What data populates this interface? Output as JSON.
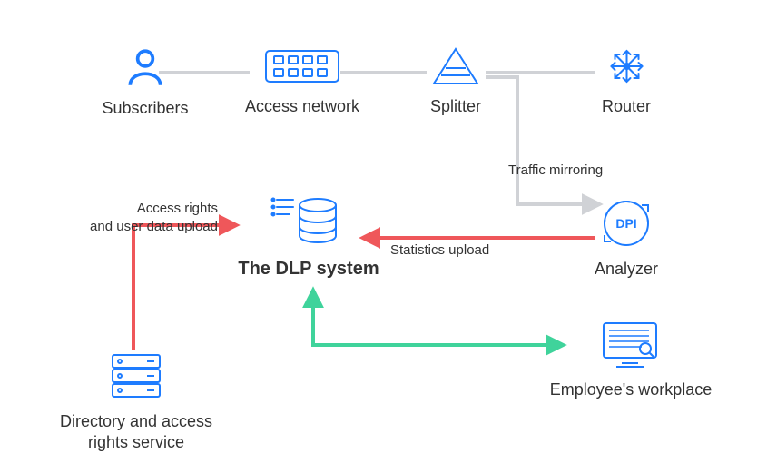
{
  "nodes": {
    "subscribers": {
      "label": "Subscribers"
    },
    "access_network": {
      "label": "Access network"
    },
    "splitter": {
      "label": "Splitter"
    },
    "router": {
      "label": "Router"
    },
    "dlp": {
      "label": "The DLP system"
    },
    "analyzer": {
      "label": "Analyzer",
      "badge": "DPI"
    },
    "directory": {
      "label": "Directory and access rights service"
    },
    "workplace": {
      "label": "Employee's workplace"
    }
  },
  "edges": {
    "traffic_mirroring": {
      "label": "Traffic mirroring"
    },
    "statistics_upload": {
      "label": "Statistics upload"
    },
    "access_rights_upload": {
      "label": "Access rights\nand user data upload"
    }
  },
  "colors": {
    "icon_blue": "#1e7cff",
    "grey": "#d0d2d6",
    "red": "#ef575a",
    "green": "#3fd39b",
    "text": "#333333"
  }
}
